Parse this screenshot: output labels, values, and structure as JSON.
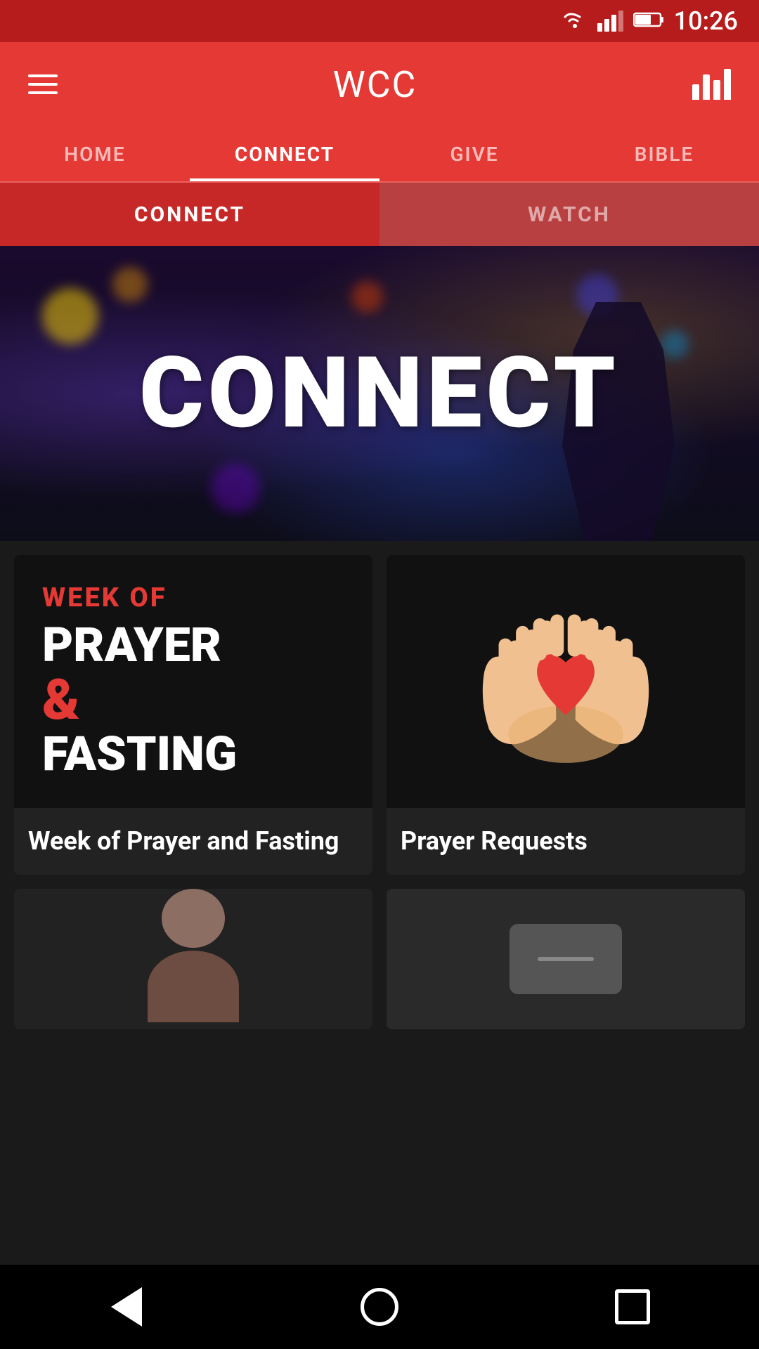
{
  "statusBar": {
    "time": "10:26"
  },
  "appBar": {
    "title": "WCC",
    "menuLabel": "Menu",
    "chartLabel": "Chart"
  },
  "topNav": {
    "items": [
      {
        "id": "home",
        "label": "HOME",
        "active": false
      },
      {
        "id": "connect",
        "label": "CONNECT",
        "active": true
      },
      {
        "id": "give",
        "label": "GIVE",
        "active": false
      },
      {
        "id": "bible",
        "label": "BIBLE",
        "active": false
      }
    ]
  },
  "subTabs": {
    "items": [
      {
        "id": "connect",
        "label": "CONNECT",
        "active": true
      },
      {
        "id": "watch",
        "label": "WATCH",
        "active": false
      }
    ]
  },
  "hero": {
    "text": "CONNECT"
  },
  "cards": [
    {
      "id": "week-of-prayer",
      "weekOf": "WEEK OF",
      "title1": "PRAYER",
      "ampersand": "&",
      "title2": "FASTING",
      "label": "Week of Prayer and Fasting"
    },
    {
      "id": "prayer-requests",
      "label": "Prayer Requests"
    }
  ],
  "bottomNav": {
    "back": "Back",
    "home": "Home",
    "recents": "Recents"
  }
}
